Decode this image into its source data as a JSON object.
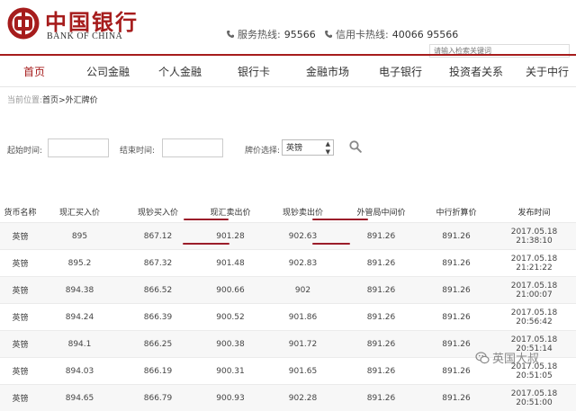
{
  "brand": {
    "name_cn": "中国银行",
    "name_en": "BANK OF CHINA"
  },
  "hotlines": [
    {
      "label": "服务热线:",
      "number": "95566"
    },
    {
      "label": "信用卡热线:",
      "number": "40066 95566"
    }
  ],
  "search": {
    "placeholder": "请输入检索关键词"
  },
  "nav": {
    "items": [
      "首页",
      "公司金融",
      "个人金融",
      "银行卡",
      "金融市场",
      "电子银行",
      "投资者关系",
      "关于中行"
    ],
    "active": "首页"
  },
  "breadcrumb": {
    "prefix": "当前位置:",
    "home": "首页",
    "sep": ">",
    "current": "外汇牌价"
  },
  "filters": {
    "start_label": "起始时间:",
    "end_label": "结束时间:",
    "currency_label": "牌价选择:",
    "currency_value": "英镑"
  },
  "table": {
    "headers": [
      "货币名称",
      "现汇买入价",
      "现钞买入价",
      "现汇卖出价",
      "现钞卖出价",
      "外管局中间价",
      "中行折算价",
      "发布时间"
    ],
    "rows": [
      [
        "英镑",
        "895",
        "867.12",
        "901.28",
        "902.63",
        "891.26",
        "891.26",
        "2017.05.18 21:38:10"
      ],
      [
        "英镑",
        "895.2",
        "867.32",
        "901.48",
        "902.83",
        "891.26",
        "891.26",
        "2017.05.18 21:21:22"
      ],
      [
        "英镑",
        "894.38",
        "866.52",
        "900.66",
        "902",
        "891.26",
        "891.26",
        "2017.05.18 21:00:07"
      ],
      [
        "英镑",
        "894.24",
        "866.39",
        "900.52",
        "901.86",
        "891.26",
        "891.26",
        "2017.05.18 20:56:42"
      ],
      [
        "英镑",
        "894.1",
        "866.25",
        "900.38",
        "901.72",
        "891.26",
        "891.26",
        "2017.05.18 20:51:14"
      ],
      [
        "英镑",
        "894.03",
        "866.19",
        "900.31",
        "901.65",
        "891.26",
        "891.26",
        "2017.05.18 20:51:05"
      ],
      [
        "英镑",
        "894.65",
        "866.79",
        "900.93",
        "902.28",
        "891.26",
        "891.26",
        "2017.05.18 20:51:00"
      ]
    ]
  },
  "watermark": {
    "text": "英国大叔"
  },
  "colors": {
    "brand_red": "#a61c1c",
    "annotation_underline": "#9b1d2a"
  }
}
